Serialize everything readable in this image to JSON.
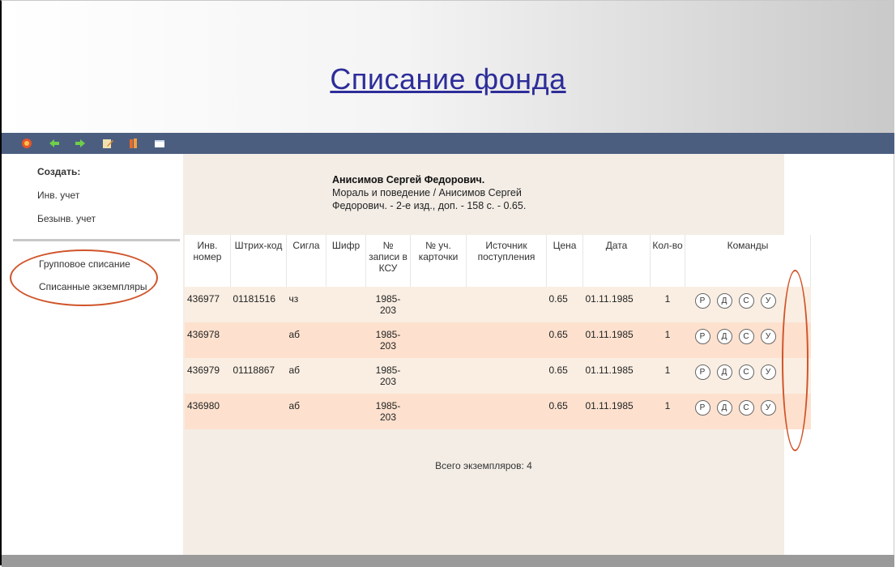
{
  "header": {
    "title": "Списание фонда"
  },
  "toolbar": {
    "icons": [
      "home-icon",
      "back-arrow-icon",
      "forward-arrow-icon",
      "edit-icon",
      "books-icon",
      "window-icon"
    ]
  },
  "sidebar": {
    "create_label": "Создать:",
    "inv_label": "Инв. учет",
    "noninv_label": "Безынв. учет",
    "group_writeoff": "Групповое списание",
    "written_off": "Списанные экземпляры"
  },
  "book": {
    "author": "Анисимов Сергей Федорович.",
    "line1": "Мораль и поведение / Анисимов Сергей",
    "line2": "Федорович. - 2-е изд., доп. - 158 с. - 0.65."
  },
  "table": {
    "headers": {
      "inv": "Инв. номер",
      "barcode": "Штрих-код",
      "sigla": "Сигла",
      "cipher": "Шифр",
      "ksu": "№ записи в КСУ",
      "card": "№ уч. карточки",
      "source": "Источник поступления",
      "price": "Цена",
      "date": "Дата",
      "qty": "Кол-во",
      "commands": "Команды"
    },
    "rows": [
      {
        "inv": "436977",
        "barcode": "01181516",
        "sigla": "чз",
        "cipher": "",
        "ksu": "1985-203",
        "card": "",
        "source": "",
        "price": "0.65",
        "date": "01.11.1985",
        "qty": "1"
      },
      {
        "inv": "436978",
        "barcode": "",
        "sigla": "аб",
        "cipher": "",
        "ksu": "1985-203",
        "card": "",
        "source": "",
        "price": "0.65",
        "date": "01.11.1985",
        "qty": "1"
      },
      {
        "inv": "436979",
        "barcode": "01118867",
        "sigla": "аб",
        "cipher": "",
        "ksu": "1985-203",
        "card": "",
        "source": "",
        "price": "0.65",
        "date": "01.11.1985",
        "qty": "1"
      },
      {
        "inv": "436980",
        "barcode": "",
        "sigla": "аб",
        "cipher": "",
        "ksu": "1985-203",
        "card": "",
        "source": "",
        "price": "0.65",
        "date": "01.11.1985",
        "qty": "1"
      }
    ],
    "commands": [
      "Р",
      "Д",
      "С",
      "У"
    ]
  },
  "total": "Всего экземпляров: 4",
  "colors": {
    "toolbar": "#4b5e80",
    "title": "#2d2d9a",
    "row_a": "#faeee2",
    "row_b": "#fde1ce",
    "annotation": "#d0542a"
  }
}
